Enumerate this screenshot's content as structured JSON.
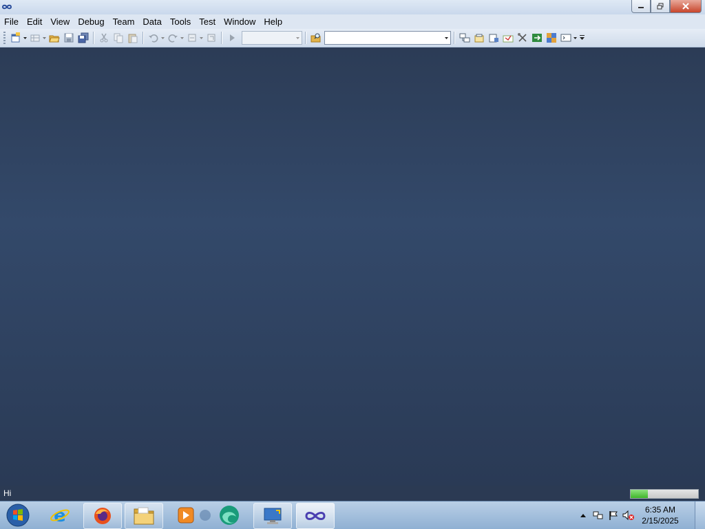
{
  "menu": {
    "items": [
      "File",
      "Edit",
      "View",
      "Debug",
      "Team",
      "Data",
      "Tools",
      "Test",
      "Window",
      "Help"
    ]
  },
  "toolbar": {
    "config_combo_value": "",
    "find_combo_value": ""
  },
  "status": {
    "text": "Hi",
    "progress": 0.25
  },
  "taskbar": {
    "time": "6:35 AM",
    "date": "2/15/2025"
  }
}
